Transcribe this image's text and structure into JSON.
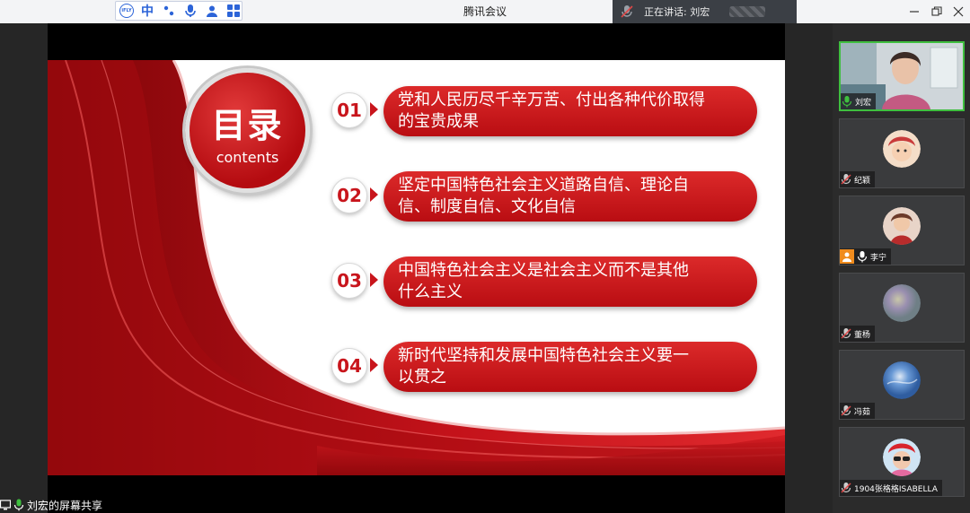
{
  "window": {
    "title": "腾讯会议",
    "speaking_label": "正在讲话: 刘宏"
  },
  "ime_toolbar": {
    "logo_text": "iFLY",
    "lang_label": "中",
    "icons": [
      "punctuation-icon",
      "microphone-icon",
      "user-icon",
      "grid-icon"
    ]
  },
  "slide": {
    "toc_title": "目录",
    "toc_subtitle": "contents",
    "items": [
      {
        "num": "01",
        "line1": "党和人民历尽千辛万苦、付出各种代价取得",
        "line2": "的宝贵成果"
      },
      {
        "num": "02",
        "line1": "坚定中国特色社会主义道路自信、理论自",
        "line2": "信、制度自信、文化自信"
      },
      {
        "num": "03",
        "line1": "中国特色社会主义是社会主义而不是其他",
        "line2": "什么主义"
      },
      {
        "num": "04",
        "line1": "新时代坚持和发展中国特色社会主义要一",
        "line2": "以贯之"
      }
    ]
  },
  "share_status": "刘宏的屏幕共享",
  "participants": [
    {
      "name": "刘宏",
      "mic": "on",
      "video": true
    },
    {
      "name": "纪颖",
      "mic": "muted"
    },
    {
      "name": "李宁",
      "mic": "on",
      "badge": "person"
    },
    {
      "name": "董杨",
      "mic": "muted"
    },
    {
      "name": "冯茹",
      "mic": "muted"
    },
    {
      "name": "1904张格格ISABELLA",
      "mic": "muted"
    }
  ],
  "colors": {
    "accent_red": "#c8151c",
    "speaking_green": "#3fbf3f"
  }
}
